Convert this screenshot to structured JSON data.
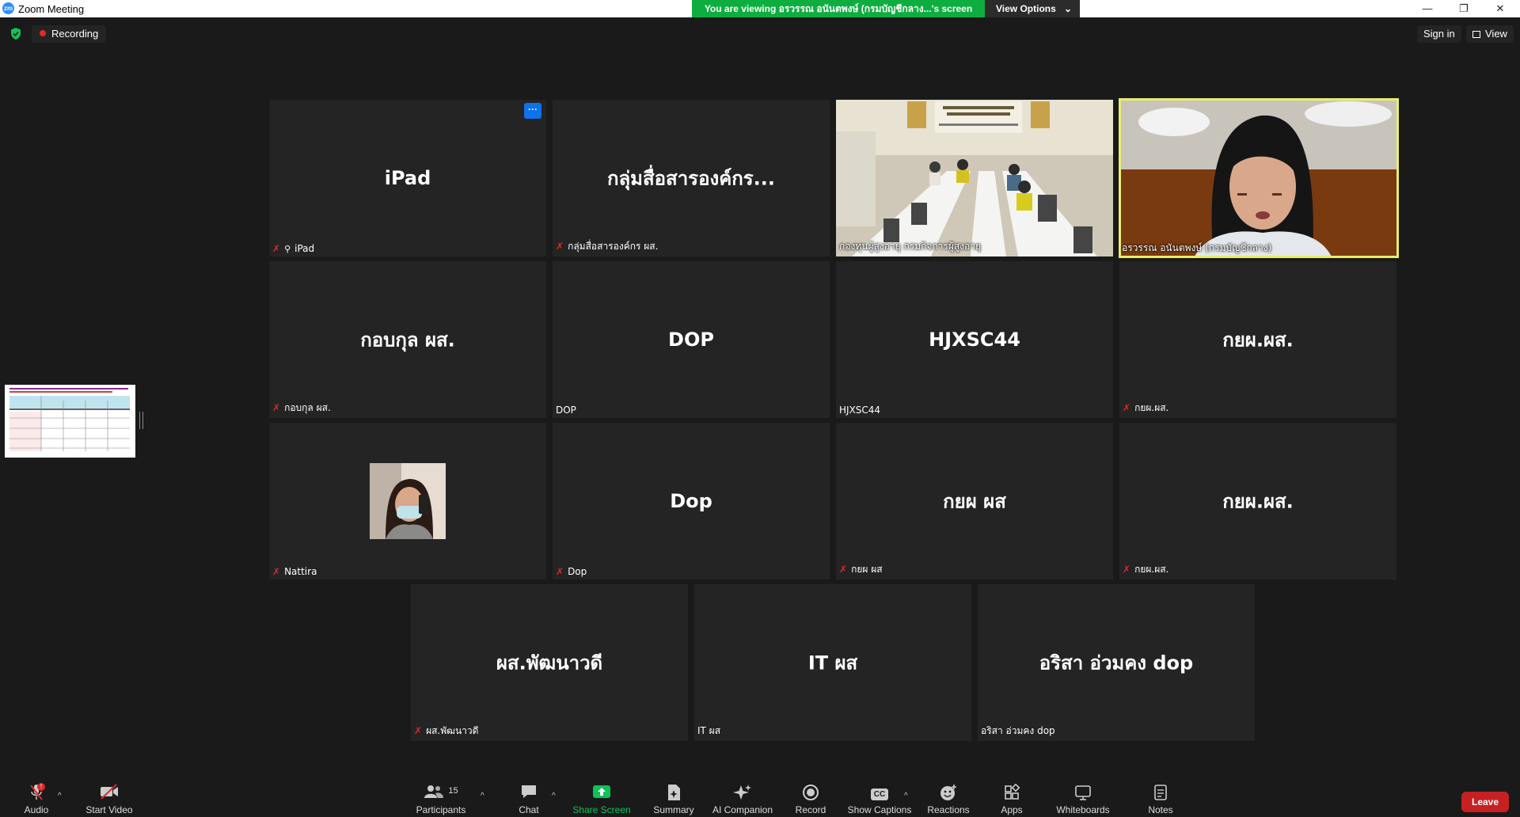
{
  "window": {
    "title": "Zoom Meeting",
    "logo": "zm",
    "minimize": "—",
    "restore": "❐",
    "close": "✕"
  },
  "banner": {
    "text": "You are viewing อรวรรณ อนันตพงษ์ (กรมบัญชีกลาง...'s screen",
    "view_options": "View Options",
    "chevron": "⌄"
  },
  "topbar": {
    "recording": "Recording",
    "sign_in": "Sign in",
    "view": "View"
  },
  "tiles": [
    {
      "big": "iPad",
      "name": "iPad",
      "muted": true,
      "pinned": true
    },
    {
      "big": "กลุ่มสื่อสารองค์กร...",
      "name": "กลุ่มสื่อสารองค์กร ผส.",
      "muted": true
    },
    {
      "name": "กองทุนผู้สูงอายุ กรมกิจการผู้สูงอายุ",
      "video": "meeting-room"
    },
    {
      "name": "อรวรรณ อนันตพงษ์ (กรมบัญชีกลาง)",
      "video": "speaker",
      "active": true
    },
    {
      "big": "กอบกุล ผส.",
      "name": "กอบกุล ผส.",
      "muted": true
    },
    {
      "big": "DOP",
      "name": "DOP"
    },
    {
      "big": "HJXSC44",
      "name": "HJXSC44"
    },
    {
      "big": "กยผ.ผส.",
      "name": "กยผ.ผส.",
      "muted": true
    },
    {
      "name": "Nattira",
      "muted": true,
      "video": "profile-photo"
    },
    {
      "big": "Dop",
      "name": "Dop",
      "muted": true
    },
    {
      "big": "กยผ ผส",
      "name": "กยผ ผส",
      "muted": true
    },
    {
      "big": "กยผ.ผส.",
      "name": "กยผ.ผส.",
      "muted": true
    },
    {
      "big": "ผส.พัฒนาวดี",
      "name": "ผส.พัฒนาวดี",
      "muted": true
    },
    {
      "big": "IT ผส",
      "name": "IT ผส"
    },
    {
      "big": "อริสา อ่วมคง dop",
      "name": "อริสา อ่วมคง dop"
    }
  ],
  "toolbar": {
    "audio": "Audio",
    "audio_badge": "!",
    "start_video": "Start Video",
    "participants": "Participants",
    "participants_count": "15",
    "chat": "Chat",
    "share_screen": "Share Screen",
    "summary": "Summary",
    "ai_companion": "AI Companion",
    "record": "Record",
    "show_captions": "Show Captions",
    "captions_icon": "CC",
    "reactions": "Reactions",
    "apps": "Apps",
    "whiteboards": "Whiteboards",
    "notes": "Notes",
    "leave": "Leave",
    "caret": "^"
  },
  "icons": {
    "more": "···",
    "muted": "🎙",
    "pin": "📌"
  },
  "colors": {
    "banner_green": "#0dae3f",
    "active_speaker": "#e9ec6e",
    "muted_red": "#e02828",
    "leave_red": "#c62121",
    "share_green": "#0dc35a",
    "tile_bg": "#242424"
  }
}
